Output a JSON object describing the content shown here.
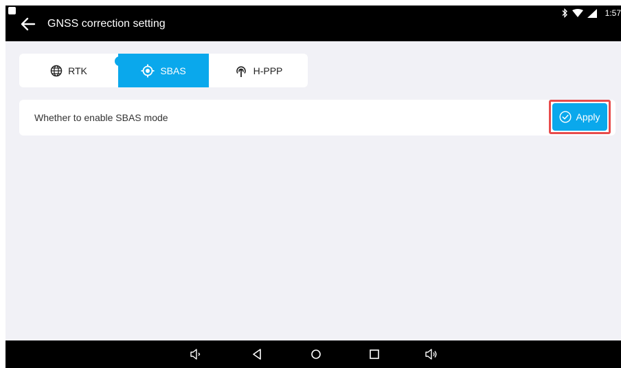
{
  "header": {
    "title": "GNSS correction setting",
    "time": "1:57"
  },
  "tabs": [
    {
      "label": "RTK",
      "icon": "globe-icon",
      "selected": false
    },
    {
      "label": "SBAS",
      "icon": "target-icon",
      "selected": true
    },
    {
      "label": "H-PPP",
      "icon": "antenna-icon",
      "selected": false
    }
  ],
  "setting": {
    "label": "Whether to enable SBAS mode",
    "apply_label": "Apply"
  },
  "colors": {
    "accent": "#0aa8ec",
    "highlight": "#e84b4b",
    "background": "#f1f1f6"
  },
  "navbar": {
    "buttons": [
      "volume-down-icon",
      "back-nav-icon",
      "home-icon",
      "recents-icon",
      "volume-up-icon"
    ]
  }
}
